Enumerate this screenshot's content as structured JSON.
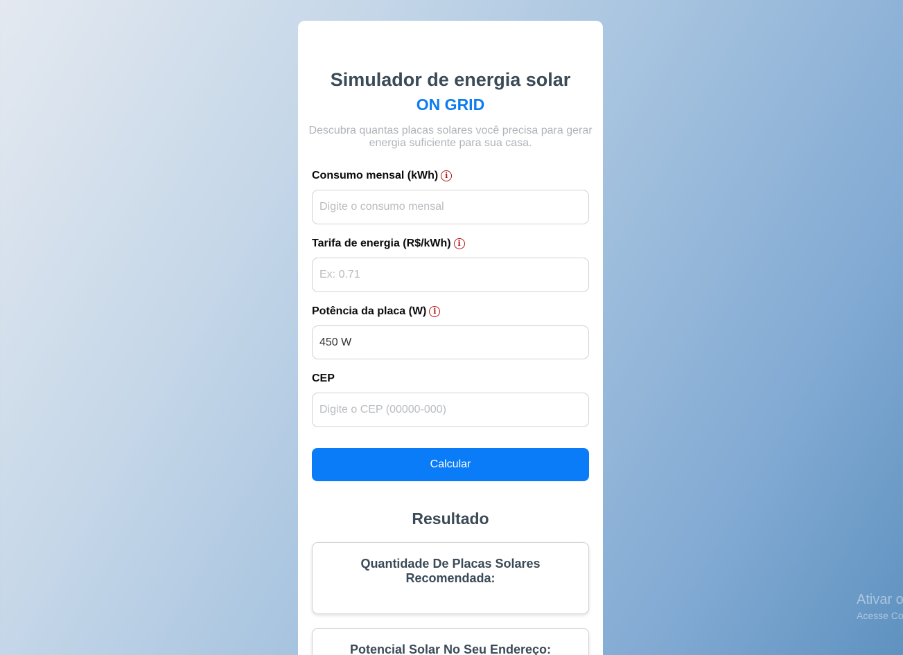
{
  "header": {
    "title": "Simulador de energia solar",
    "subtitle": "ON GRID",
    "description": "Descubra quantas placas solares você precisa para gerar energia suficiente para sua casa."
  },
  "form": {
    "consumo": {
      "label": "Consumo mensal (kWh)",
      "placeholder": "Digite o consumo mensal",
      "value": ""
    },
    "tarifa": {
      "label": "Tarifa de energia (R$/kWh)",
      "placeholder": "Ex: 0.71",
      "value": ""
    },
    "potencia": {
      "label": "Potência da placa (W)",
      "selected": "450 W"
    },
    "cep": {
      "label": "CEP",
      "placeholder": "Digite o CEP (00000-000)",
      "value": ""
    },
    "submit_label": "Calcular"
  },
  "result": {
    "title": "Resultado",
    "placas_label": "Quantidade De Placas Solares Recomendada:",
    "potencial_label": "Potencial Solar No Seu Endereço:"
  },
  "watermark": {
    "line1": "Ativar o",
    "line2": "Acesse Co"
  },
  "colors": {
    "accent": "#0b7cf7",
    "info_icon": "#b41414",
    "title": "#3a4a56"
  },
  "icons": {
    "info": "info-circle-icon"
  }
}
